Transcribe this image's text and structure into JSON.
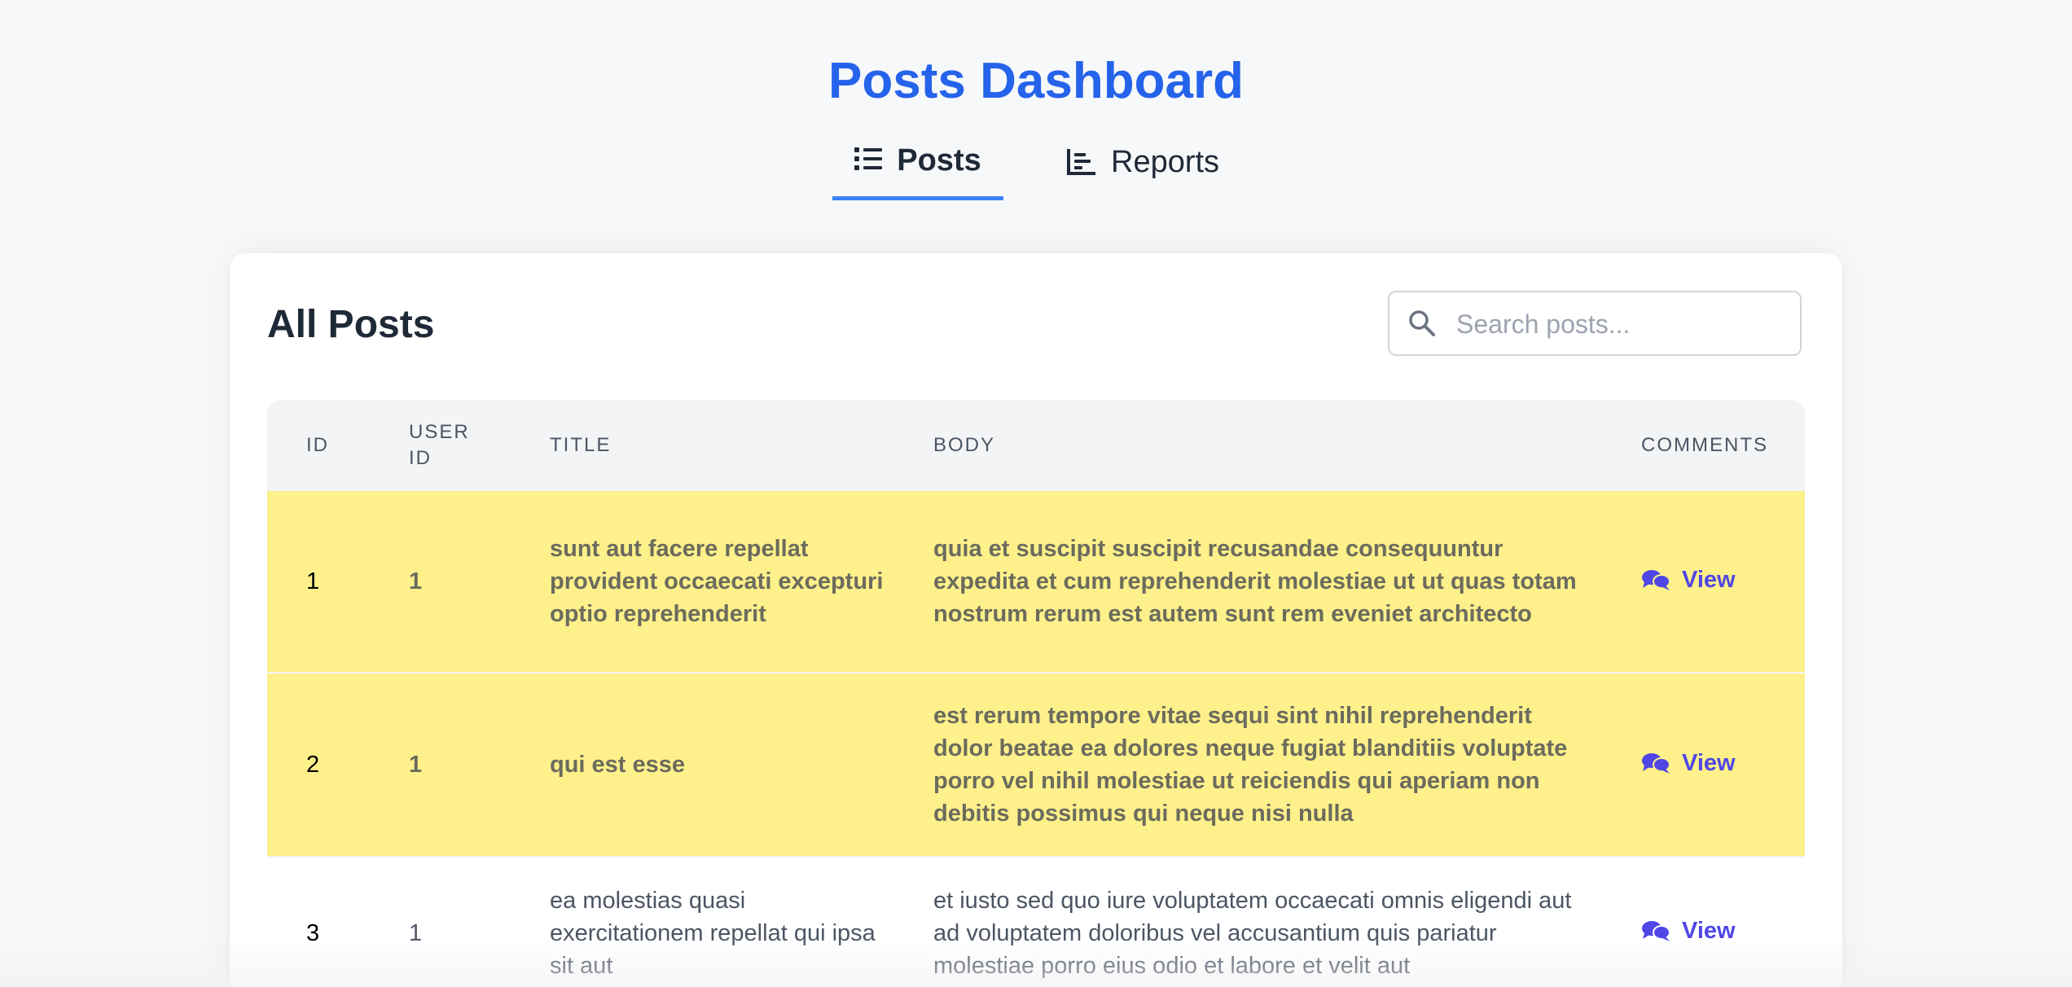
{
  "header": {
    "title": "Posts Dashboard"
  },
  "tabs": [
    {
      "label": "Posts",
      "icon": "list-icon",
      "active": true
    },
    {
      "label": "Reports",
      "icon": "bar-chart-icon",
      "active": false
    }
  ],
  "main": {
    "card_title": "All Posts",
    "search": {
      "placeholder": "Search posts...",
      "value": "",
      "icon": "search-icon"
    },
    "table": {
      "columns": [
        "ID",
        "USER ID",
        "TITLE",
        "BODY",
        "COMMENTS"
      ],
      "rows": [
        {
          "id": "1",
          "user_id": "1",
          "title": "sunt aut facere repellat provident occaecati excepturi optio reprehenderit",
          "body": "quia et suscipit suscipit recusandae consequuntur expedita et cum reprehenderit molestiae ut ut quas totam nostrum rerum est autem sunt rem eveniet architecto",
          "comments_label": "View",
          "highlighted": true
        },
        {
          "id": "2",
          "user_id": "1",
          "title": "qui est esse",
          "body": "est rerum tempore vitae sequi sint nihil reprehenderit dolor beatae ea dolores neque fugiat blanditiis voluptate porro vel nihil molestiae ut reiciendis qui aperiam non debitis possimus qui neque nisi nulla",
          "comments_label": "View",
          "highlighted": true
        },
        {
          "id": "3",
          "user_id": "1",
          "title": "ea molestias quasi exercitationem repellat qui ipsa sit aut",
          "body": "et iusto sed quo iure voluptatem occaecati omnis eligendi aut ad voluptatem doloribus vel accusantium quis pariatur molestiae porro eius odio et labore et velit aut",
          "comments_label": "View",
          "highlighted": false
        }
      ]
    }
  },
  "colors": {
    "accent": "#2563eb",
    "tab_underline": "#3b82f6",
    "highlight_row": "#fef08a",
    "link": "#4f46e5",
    "background": "#f7f8fa"
  }
}
